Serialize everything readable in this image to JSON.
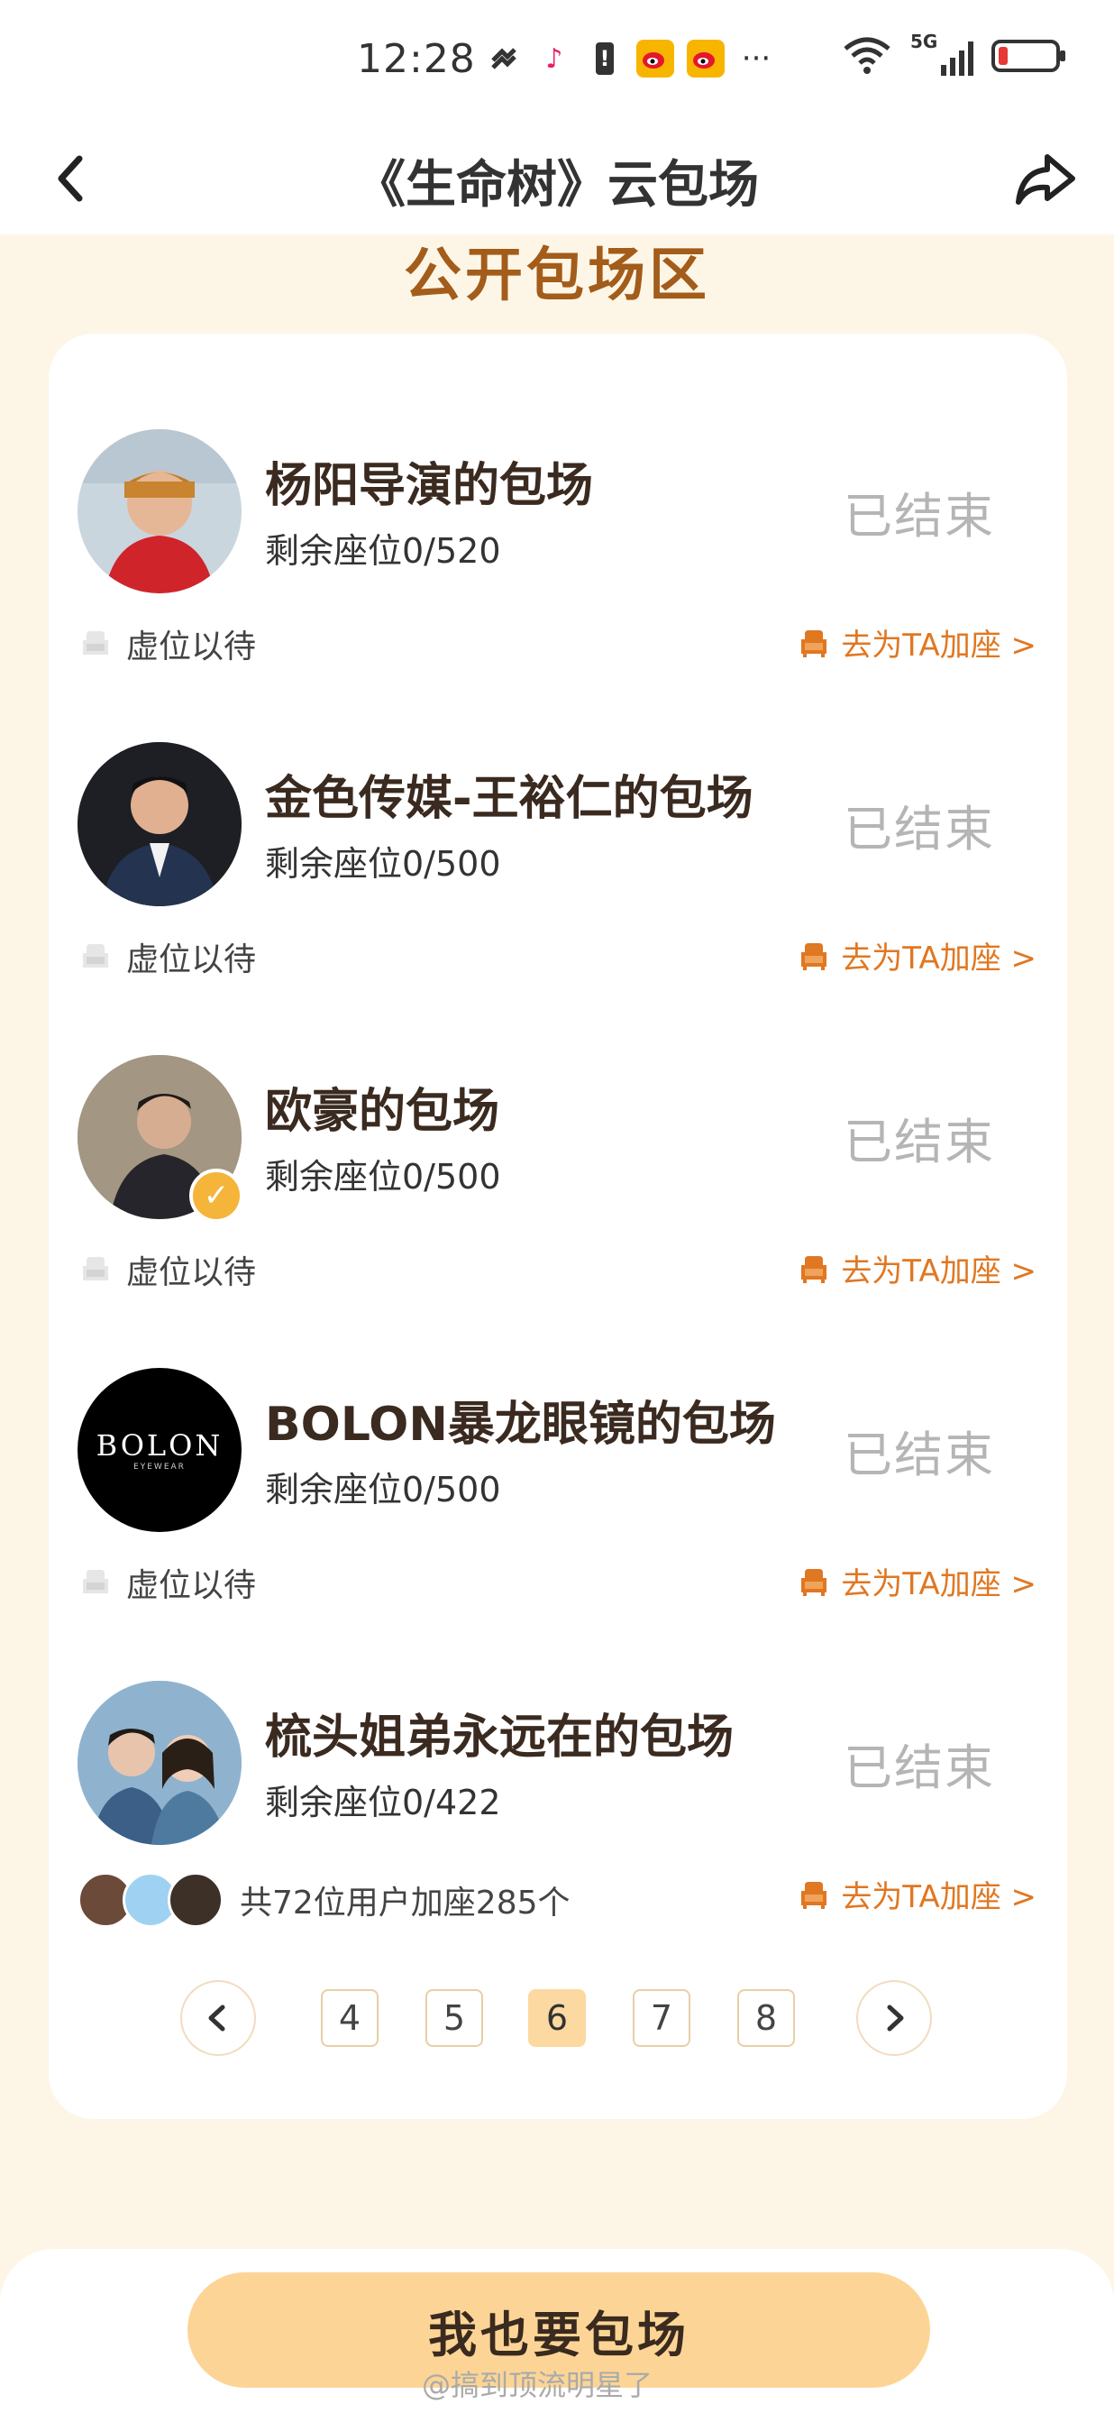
{
  "status_bar": {
    "time": "12:28",
    "network": "5G"
  },
  "header": {
    "title": "《生命树》云包场"
  },
  "section": {
    "title": "公开包场区"
  },
  "items": [
    {
      "name": "杨阳导演的包场",
      "seats": "剩余座位0/520",
      "status": "已结束",
      "footer_left": "虚位以待",
      "action": "去为TA加座 >"
    },
    {
      "name": "金色传媒-王裕仁的包场",
      "seats": "剩余座位0/500",
      "status": "已结束",
      "footer_left": "虚位以待",
      "action": "去为TA加座 >"
    },
    {
      "name": "欧豪的包场",
      "seats": "剩余座位0/500",
      "status": "已结束",
      "footer_left": "虚位以待",
      "action": "去为TA加座 >"
    },
    {
      "name": "BOLON暴龙眼镜的包场",
      "seats": "剩余座位0/500",
      "status": "已结束",
      "footer_left": "虚位以待",
      "action": "去为TA加座 >",
      "avatar_text": "BOLON",
      "avatar_subtext": "EYEWEAR"
    },
    {
      "name": "梳头姐弟永远在的包场",
      "seats": "剩余座位0/422",
      "status": "已结束",
      "footer_left": "共72位用户加座285个",
      "action": "去为TA加座 >"
    }
  ],
  "pagination": {
    "pages": [
      "4",
      "5",
      "6",
      "7",
      "8"
    ],
    "current": "6"
  },
  "cta": {
    "label": "我也要包场"
  },
  "watermark": "@搞到顶流明星了",
  "colors": {
    "accent": "#e07722",
    "title_brown": "#a35c1a",
    "cta_bg": "#fcd596",
    "page_bg": "#fdf6e6"
  }
}
